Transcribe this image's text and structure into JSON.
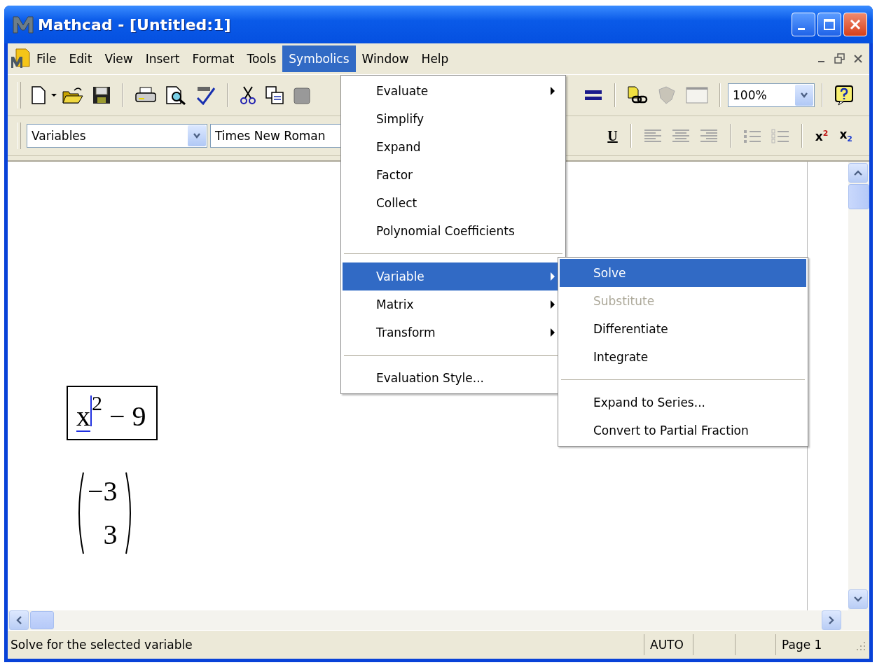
{
  "window": {
    "title": "Mathcad - [Untitled:1]"
  },
  "menu_bar": [
    {
      "label": "File",
      "selected": false
    },
    {
      "label": "Edit",
      "selected": false
    },
    {
      "label": "View",
      "selected": false
    },
    {
      "label": "Insert",
      "selected": false
    },
    {
      "label": "Format",
      "selected": false
    },
    {
      "label": "Tools",
      "selected": false
    },
    {
      "label": "Symbolics",
      "selected": true
    },
    {
      "label": "Window",
      "selected": false
    },
    {
      "label": "Help",
      "selected": false
    }
  ],
  "standard_toolbar": {
    "zoom": "100%"
  },
  "format_toolbar": {
    "style": "Variables",
    "font": "Times New Roman",
    "buttons": [
      {
        "kind": "underline",
        "label": "U"
      },
      {
        "kind": "superscript",
        "label": "x$^{2}$"
      },
      {
        "kind": "subscript",
        "label": "x$_{2}$"
      }
    ]
  },
  "worksheet": {
    "expression": {
      "base": "x",
      "exponent": "2",
      "rest": "− 9"
    },
    "result": [
      "−3",
      "3"
    ]
  },
  "symbolics_menu": {
    "sections": [
      [
        {
          "label": "Evaluate",
          "submenu": true,
          "selected": false,
          "disabled": false
        },
        {
          "label": "Simplify",
          "submenu": false,
          "selected": false,
          "disabled": false
        },
        {
          "label": "Expand",
          "submenu": false,
          "selected": false,
          "disabled": false
        },
        {
          "label": "Factor",
          "submenu": false,
          "selected": false,
          "disabled": false
        },
        {
          "label": "Collect",
          "submenu": false,
          "selected": false,
          "disabled": false
        },
        {
          "label": "Polynomial Coefficients",
          "submenu": false,
          "selected": false,
          "disabled": false
        }
      ],
      [
        {
          "label": "Variable",
          "submenu": true,
          "selected": true,
          "disabled": false
        },
        {
          "label": "Matrix",
          "submenu": true,
          "selected": false,
          "disabled": false
        },
        {
          "label": "Transform",
          "submenu": true,
          "selected": false,
          "disabled": false
        }
      ],
      [
        {
          "label": "Evaluation Style...",
          "submenu": false,
          "selected": false,
          "disabled": false
        }
      ]
    ]
  },
  "variable_submenu": {
    "sections": [
      [
        {
          "label": "Solve",
          "submenu": false,
          "selected": true,
          "disabled": false
        },
        {
          "label": "Substitute",
          "submenu": false,
          "selected": false,
          "disabled": true
        },
        {
          "label": "Differentiate",
          "submenu": false,
          "selected": false,
          "disabled": false
        },
        {
          "label": "Integrate",
          "submenu": false,
          "selected": false,
          "disabled": false
        }
      ],
      [
        {
          "label": "Expand to Series...",
          "submenu": false,
          "selected": false,
          "disabled": false
        },
        {
          "label": "Convert to Partial Fraction",
          "submenu": false,
          "selected": false,
          "disabled": false
        }
      ]
    ]
  },
  "status_bar": {
    "message": "Solve for the selected variable",
    "mode": "AUTO",
    "page": "Page 1"
  }
}
